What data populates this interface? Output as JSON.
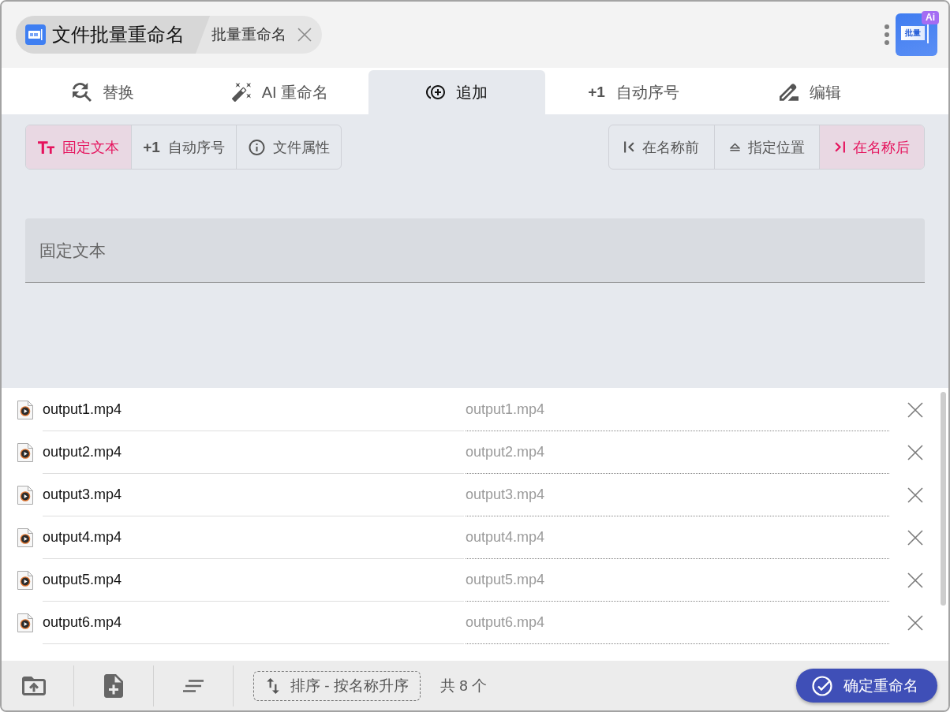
{
  "header": {
    "app_title": "文件批量重命名",
    "breadcrumb": "批量重命名",
    "logo": {
      "label": "批量",
      "badge": "Ai"
    }
  },
  "tabs": [
    {
      "label": "替换",
      "selected": false
    },
    {
      "label": "AI 重命名",
      "selected": false
    },
    {
      "label": "追加",
      "selected": true
    },
    {
      "prefix": "+1",
      "label": "自动序号",
      "selected": false
    },
    {
      "label": "编辑",
      "selected": false
    }
  ],
  "append": {
    "sources": [
      {
        "label": "固定文本",
        "selected": true
      },
      {
        "prefix": "+1",
        "label": "自动序号",
        "selected": false
      },
      {
        "label": "文件属性",
        "selected": false
      }
    ],
    "positions": [
      {
        "label": "在名称前",
        "selected": false
      },
      {
        "label": "指定位置",
        "selected": false
      },
      {
        "label": "在名称后",
        "selected": true
      }
    ],
    "text_field": {
      "placeholder": "固定文本"
    }
  },
  "files": [
    {
      "name": "output1.mp4",
      "preview": "output1.mp4"
    },
    {
      "name": "output2.mp4",
      "preview": "output2.mp4"
    },
    {
      "name": "output3.mp4",
      "preview": "output3.mp4"
    },
    {
      "name": "output4.mp4",
      "preview": "output4.mp4"
    },
    {
      "name": "output5.mp4",
      "preview": "output5.mp4"
    },
    {
      "name": "output6.mp4",
      "preview": "output6.mp4"
    }
  ],
  "footer": {
    "sort_button": "排序 - 按名称升序",
    "count": "共 8 个",
    "confirm_button": "确定重命名"
  }
}
